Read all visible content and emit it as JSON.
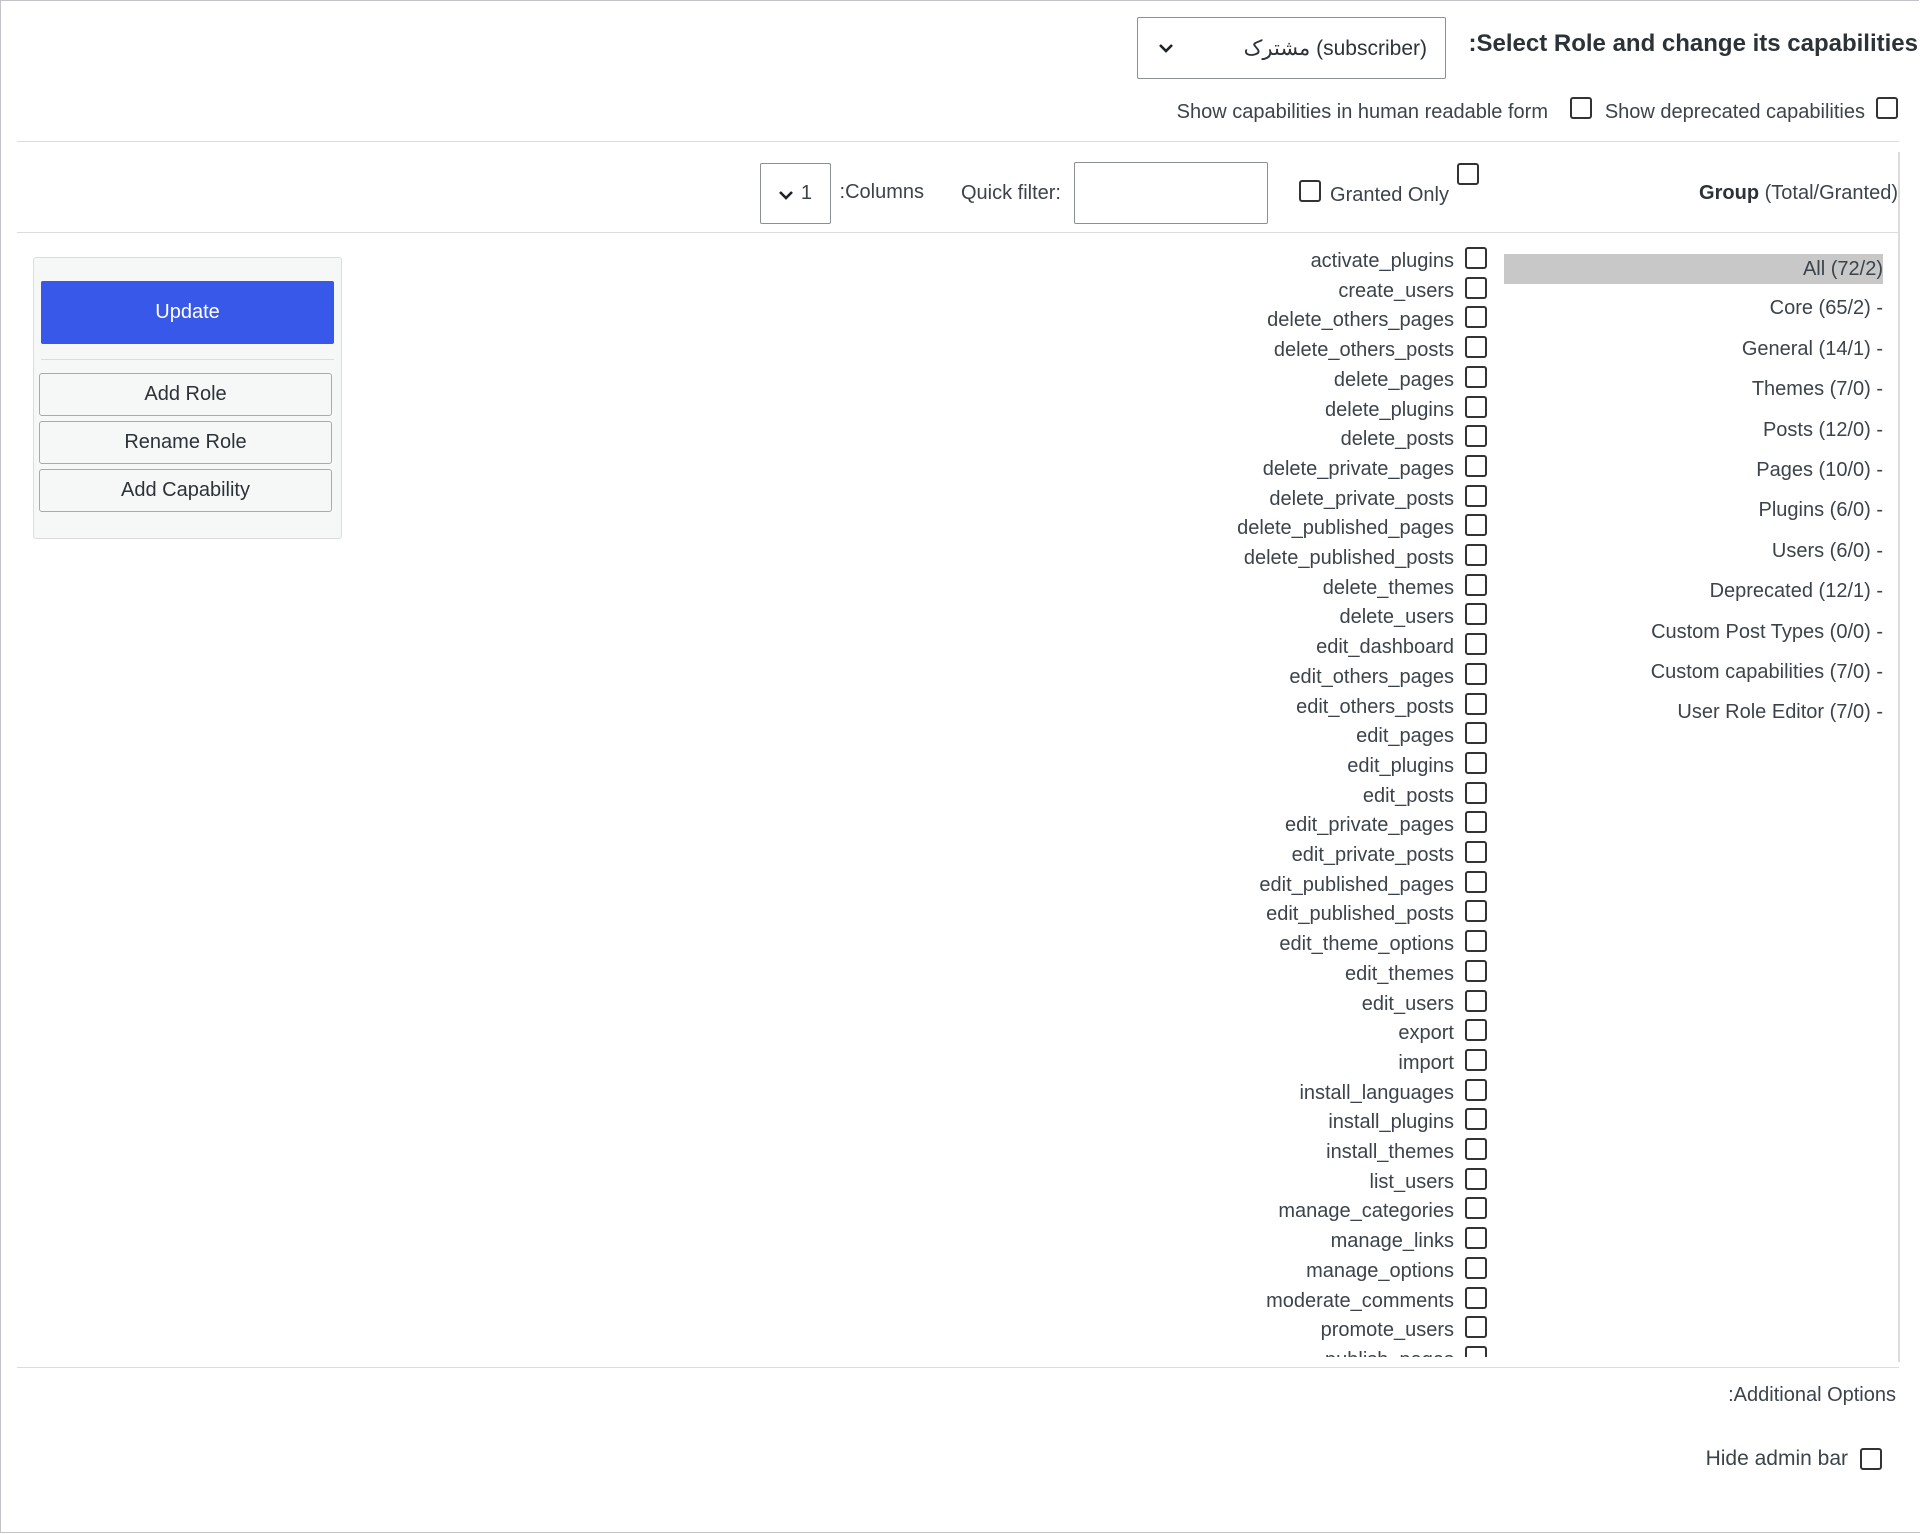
{
  "header": {
    "title": "Select Role and change its capabilities:",
    "role_selected": "مشترک (subscriber)",
    "show_human_readable_label": "Show capabilities in human readable form",
    "show_deprecated_label": "Show deprecated capabilities"
  },
  "toolbar": {
    "columns_label": "Columns:",
    "columns_value": "1",
    "quick_filter_label": "Quick filter:",
    "quick_filter_value": "",
    "granted_only_label": "Granted Only",
    "group_header_bold": "Group",
    "group_header_rest": "(Total/Granted)"
  },
  "groups": [
    {
      "label": "All (72/2)",
      "active": true
    },
    {
      "label": "Core (65/2) -"
    },
    {
      "label": "General (14/1) -"
    },
    {
      "label": "Themes (7/0) -"
    },
    {
      "label": "Posts (12/0) -"
    },
    {
      "label": "Pages (10/0) -"
    },
    {
      "label": "Plugins (6/0) -"
    },
    {
      "label": "Users (6/0) -"
    },
    {
      "label": "Deprecated (12/1) -"
    },
    {
      "label": "Custom Post Types (0/0) -"
    },
    {
      "label": "Custom capabilities (7/0) -"
    },
    {
      "label": "User Role Editor (7/0) -"
    }
  ],
  "capabilities": [
    "activate_plugins",
    "create_users",
    "delete_others_pages",
    "delete_others_posts",
    "delete_pages",
    "delete_plugins",
    "delete_posts",
    "delete_private_pages",
    "delete_private_posts",
    "delete_published_pages",
    "delete_published_posts",
    "delete_themes",
    "delete_users",
    "edit_dashboard",
    "edit_others_pages",
    "edit_others_posts",
    "edit_pages",
    "edit_plugins",
    "edit_posts",
    "edit_private_pages",
    "edit_private_posts",
    "edit_published_pages",
    "edit_published_posts",
    "edit_theme_options",
    "edit_themes",
    "edit_users",
    "export",
    "import",
    "install_languages",
    "install_plugins",
    "install_themes",
    "list_users",
    "manage_categories",
    "manage_links",
    "manage_options",
    "moderate_comments",
    "promote_users",
    "publish_pages"
  ],
  "actions": {
    "update": "Update",
    "add_role": "Add Role",
    "rename_role": "Rename Role",
    "add_capability": "Add Capability"
  },
  "additional": {
    "title": "Additional Options:",
    "hide_admin_bar": "Hide admin bar"
  },
  "colors": {
    "primary": "#3858e9",
    "active_group": "#c8c8c8"
  }
}
